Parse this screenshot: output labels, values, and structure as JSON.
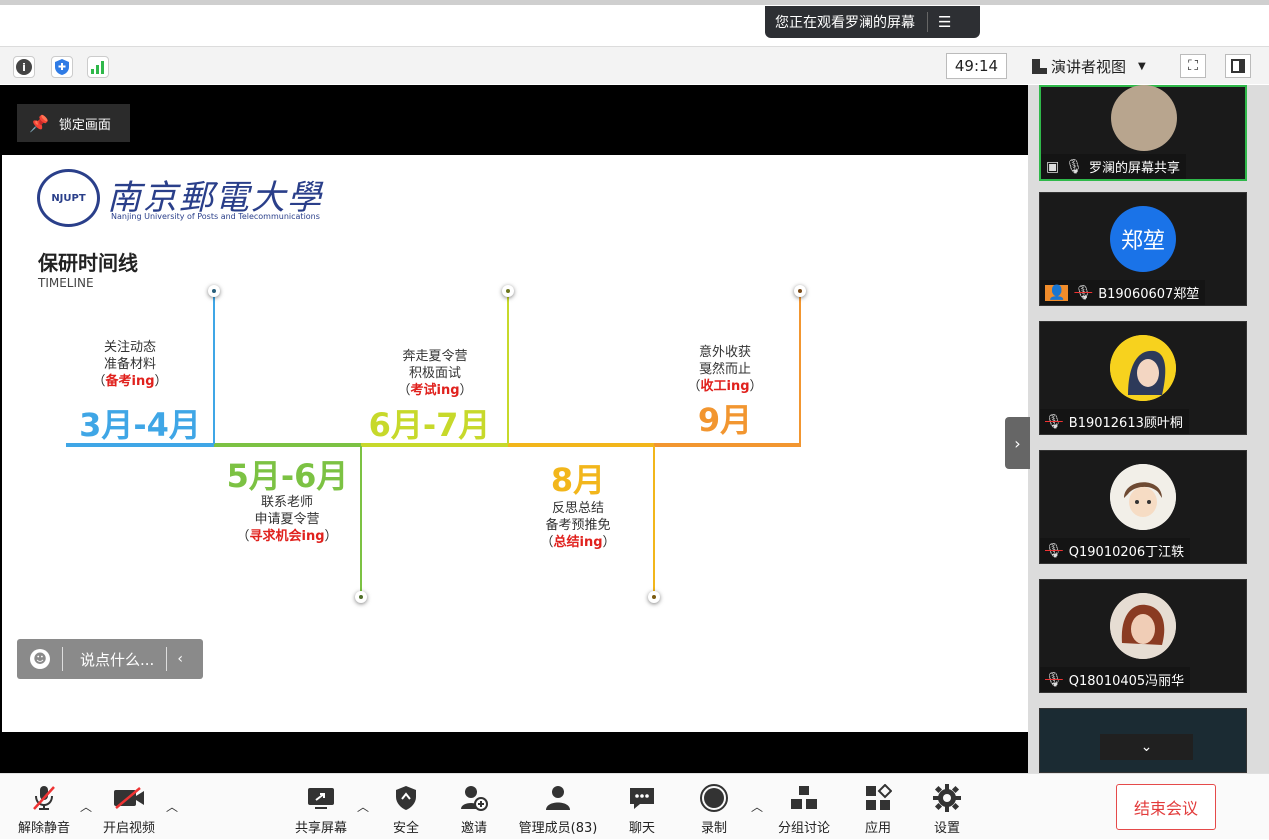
{
  "banner": {
    "text": "您正在观看罗澜的屏幕",
    "menu_icon": "list-icon"
  },
  "toolbar": {
    "timer": "49:14",
    "view_label": "演讲者视图",
    "icons": [
      "info-icon",
      "shield-icon",
      "signal-icon",
      "fullscreen-icon",
      "side-panel-icon"
    ]
  },
  "pin": {
    "label": "锁定画面"
  },
  "slide": {
    "logo_cn": "南京郵電大學",
    "logo_en": "Nanjing University of Posts and Telecommunications",
    "title": "保研时间线",
    "subtitle": "TIMELINE",
    "stages": [
      {
        "period": "3月-4月",
        "line1": "关注动态",
        "line2": "准备材料",
        "tag": "备考ing",
        "color": "#3fa6e6"
      },
      {
        "period": "5月-6月",
        "line1": "联系老师",
        "line2": "申请夏令营",
        "tag": "寻求机会ing",
        "color": "#7cc243"
      },
      {
        "period": "6月-7月",
        "line1": "奔走夏令营",
        "line2": "积极面试",
        "tag": "考试ing",
        "color": "#c7d92b"
      },
      {
        "period": "8月",
        "line1": "反思总结",
        "line2": "备考预推免",
        "tag": "总结ing",
        "color": "#f2b61b"
      },
      {
        "period": "9月",
        "line1": "意外收获",
        "line2": "戛然而止",
        "tag": "收工ing",
        "color": "#f29630"
      }
    ]
  },
  "chat": {
    "placeholder": "说点什么..."
  },
  "participants": [
    {
      "name": "罗澜的屏幕共享",
      "avatar_text": ""
    },
    {
      "name": "B19060607郑堃",
      "avatar_text": "郑堃"
    },
    {
      "name": "B19012613顾叶桐",
      "avatar_text": ""
    },
    {
      "name": "Q19010206丁江轶",
      "avatar_text": ""
    },
    {
      "name": "Q18010405冯丽华",
      "avatar_text": ""
    }
  ],
  "bottombar": {
    "unmute": "解除静音",
    "video": "开启视频",
    "share": "共享屏幕",
    "security": "安全",
    "invite": "邀请",
    "members": "管理成员(83)",
    "chat": "聊天",
    "record": "录制",
    "breakout": "分组讨论",
    "apps": "应用",
    "settings": "设置",
    "end": "结束会议"
  }
}
